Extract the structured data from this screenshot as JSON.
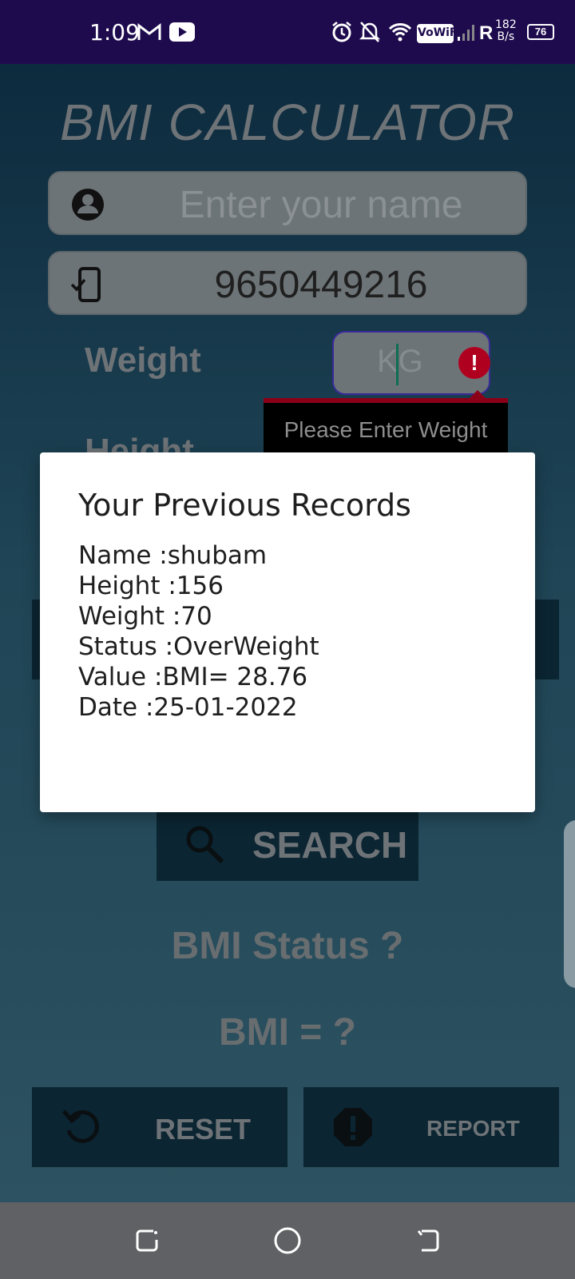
{
  "status_bar": {
    "time": "1:09",
    "icons": [
      "gmail-icon",
      "youtube-icon",
      "alarm-icon",
      "mute-icon",
      "wifi-icon",
      "vowifi-icon",
      "signal-icon"
    ],
    "vowifi": "VoWiFi",
    "roaming": "R",
    "net_speed_value": "182",
    "net_speed_unit": "B/s",
    "battery": "76"
  },
  "app": {
    "title": "BMI CALCULATOR",
    "name_field": {
      "placeholder": "Enter your name",
      "value": ""
    },
    "phone_field": {
      "value": "9650449216"
    },
    "weight_label": "Weight",
    "height_label": "Height",
    "weight_field": {
      "placeholder": "KG",
      "value": ""
    },
    "weight_error": "Please Enter Weight",
    "search_label": "SEARCH",
    "bmi_status": "BMI Status ?",
    "bmi_value": "BMI = ?",
    "reset_label": "RESET",
    "report_label": "REPORT"
  },
  "dialog": {
    "title": "Your Previous Records",
    "lines": [
      "Name :shubam",
      "Height :156",
      "Weight :70",
      "Status :OverWeight",
      "Value :BMI= 28.76",
      "Date :25-01-2022"
    ]
  },
  "colors": {
    "status_bar": "#1e0b4e",
    "error": "#b00020",
    "button_bg": "#0b2532",
    "dialog_bg": "#ffffff",
    "nav_bar": "#5f6164"
  }
}
